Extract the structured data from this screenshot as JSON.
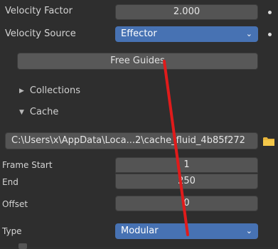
{
  "fluid": {
    "velocity_factor": {
      "label": "Velocity Factor",
      "value": "2.000"
    },
    "velocity_source": {
      "label": "Velocity Source",
      "value": "Effector"
    },
    "free_guides_button": "Free Guides"
  },
  "subpanels": {
    "collections": "Collections",
    "cache": "Cache"
  },
  "cache": {
    "path": "C:\\Users\\x\\AppData\\Loca...2\\cache_fluid_4b85f272",
    "frame_start": {
      "label": "Frame Start",
      "value": "1"
    },
    "end": {
      "label": "End",
      "value": "250"
    },
    "offset": {
      "label": "Offset",
      "value": "0"
    },
    "type": {
      "label": "Type",
      "value": "Modular"
    }
  },
  "colors": {
    "accent": "#4772b3",
    "annotation": "#e01b1b",
    "folder": "#e8b53b"
  },
  "icons": {
    "dropdown": "chevron-down-icon",
    "folder": "folder-icon",
    "collapsed": "triangle-right-icon",
    "expanded": "triangle-down-icon",
    "keyframe": "keyframe-dot-icon"
  }
}
